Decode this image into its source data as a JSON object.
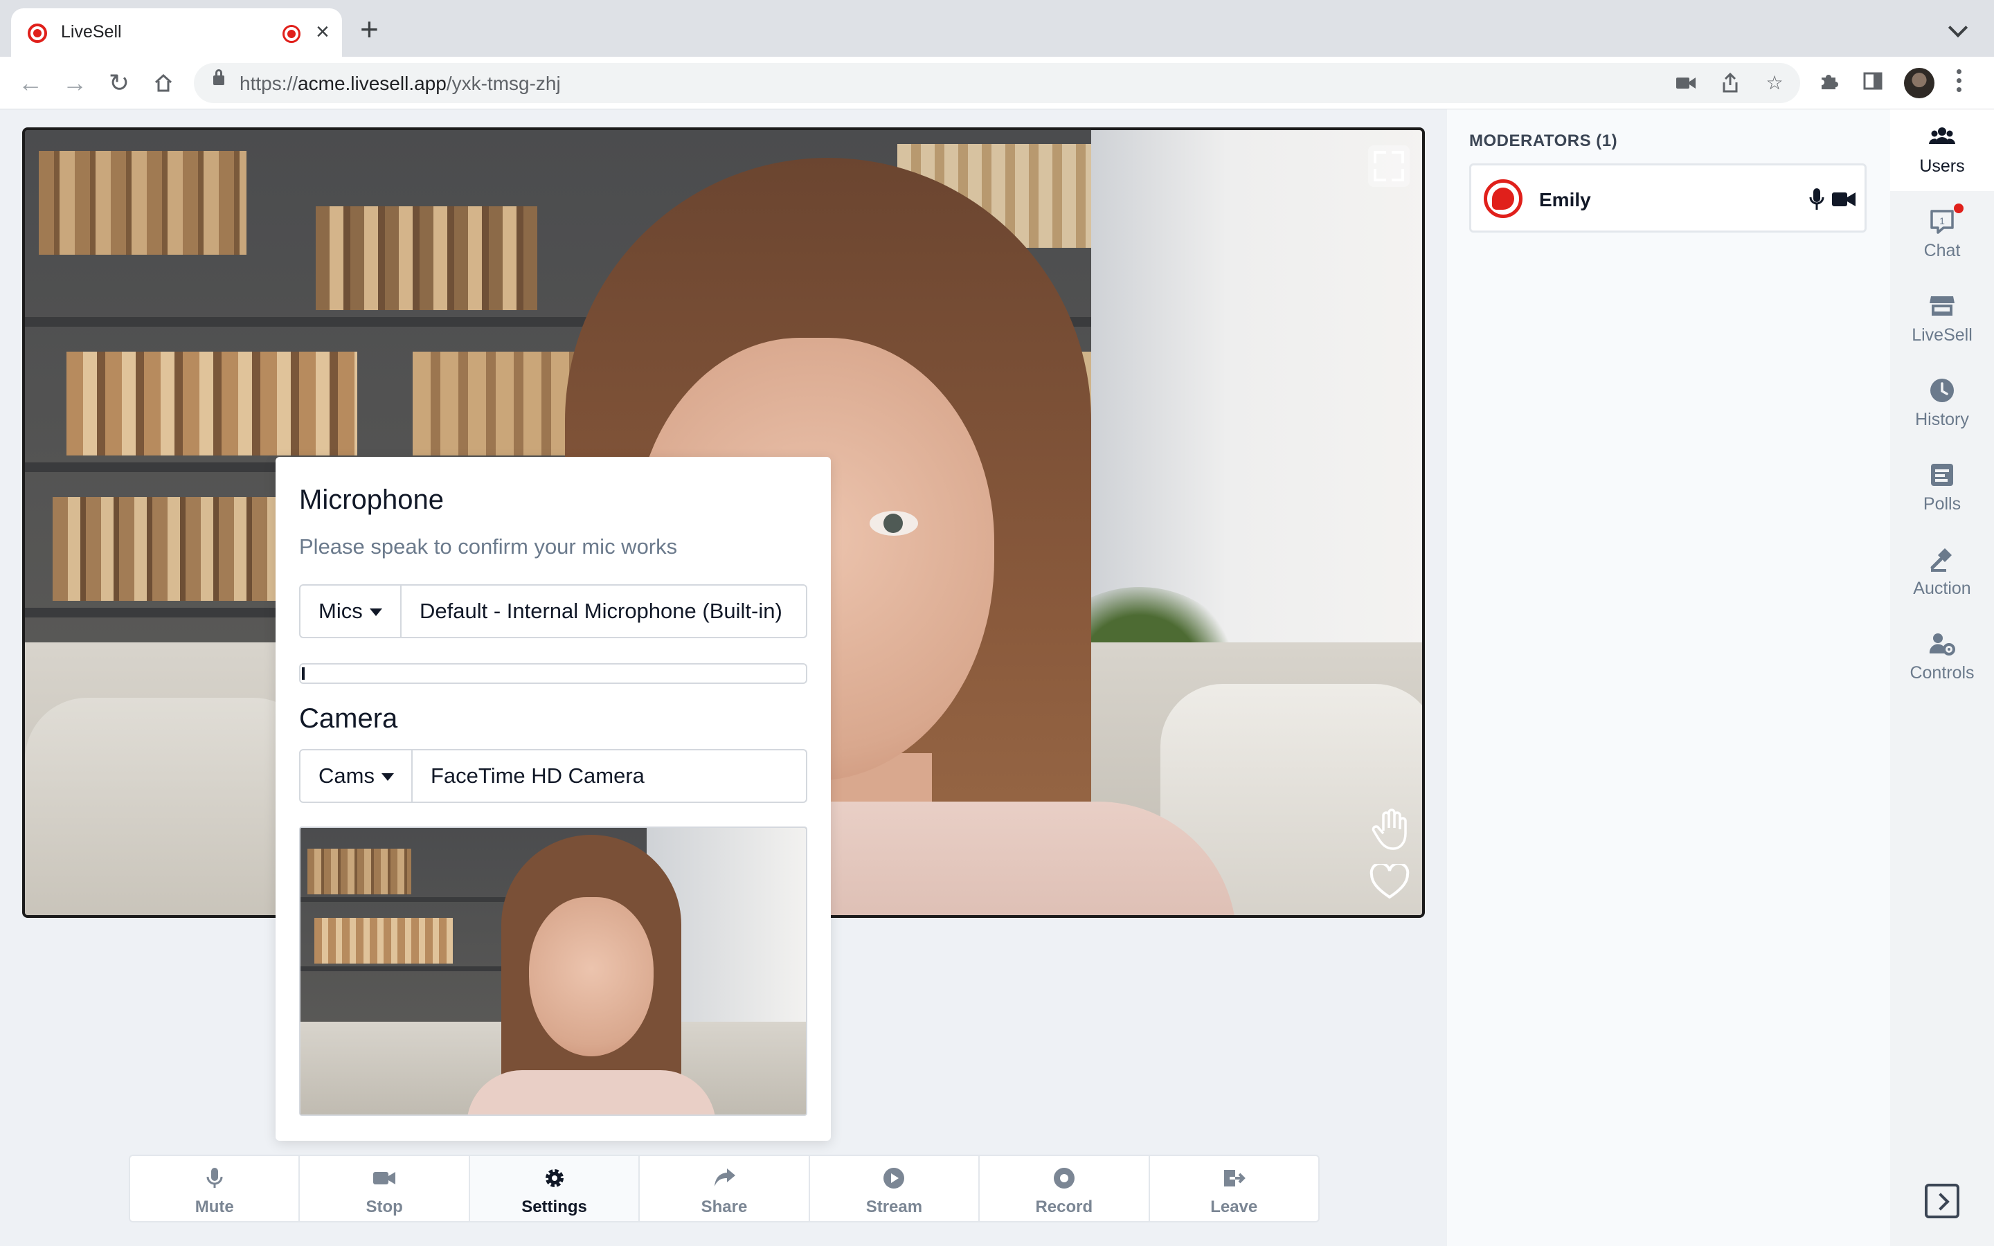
{
  "browser": {
    "tab_title": "LiveSell",
    "url_scheme": "https://",
    "url_host": "acme.livesell.app",
    "url_path": "/yxk-tmsg-zhj"
  },
  "settings_popover": {
    "mic_heading": "Microphone",
    "mic_subtitle": "Please speak to confirm your mic works",
    "mic_dropdown_label": "Mics",
    "mic_selected": "Default - Internal Microphone (Built-in)",
    "mic_level_percent": 0.5,
    "cam_heading": "Camera",
    "cam_dropdown_label": "Cams",
    "cam_selected": "FaceTime HD Camera"
  },
  "actions": [
    {
      "label": "Mute",
      "icon": "mic-icon"
    },
    {
      "label": "Stop",
      "icon": "video-camera-icon"
    },
    {
      "label": "Settings",
      "icon": "gear-icon",
      "active": true
    },
    {
      "label": "Share",
      "icon": "share-arrow-icon"
    },
    {
      "label": "Stream",
      "icon": "play-circle-icon"
    },
    {
      "label": "Record",
      "icon": "record-icon"
    },
    {
      "label": "Leave",
      "icon": "leave-icon"
    }
  ],
  "users_panel": {
    "title": "MODERATORS (1)",
    "users": [
      {
        "name": "Emily",
        "mic": true,
        "camera": true
      }
    ]
  },
  "side_nav": [
    {
      "label": "Users",
      "icon": "users-icon",
      "active": true
    },
    {
      "label": "Chat",
      "icon": "chat-icon",
      "badge": true
    },
    {
      "label": "LiveSell",
      "icon": "store-icon"
    },
    {
      "label": "History",
      "icon": "clock-icon"
    },
    {
      "label": "Polls",
      "icon": "poll-icon"
    },
    {
      "label": "Auction",
      "icon": "gavel-icon"
    },
    {
      "label": "Controls",
      "icon": "user-cog-icon"
    }
  ],
  "colors": {
    "accent_red": "#e0201b",
    "active_text": "#111827",
    "muted_text": "#7b8694",
    "page_bg": "#eef1f5"
  }
}
